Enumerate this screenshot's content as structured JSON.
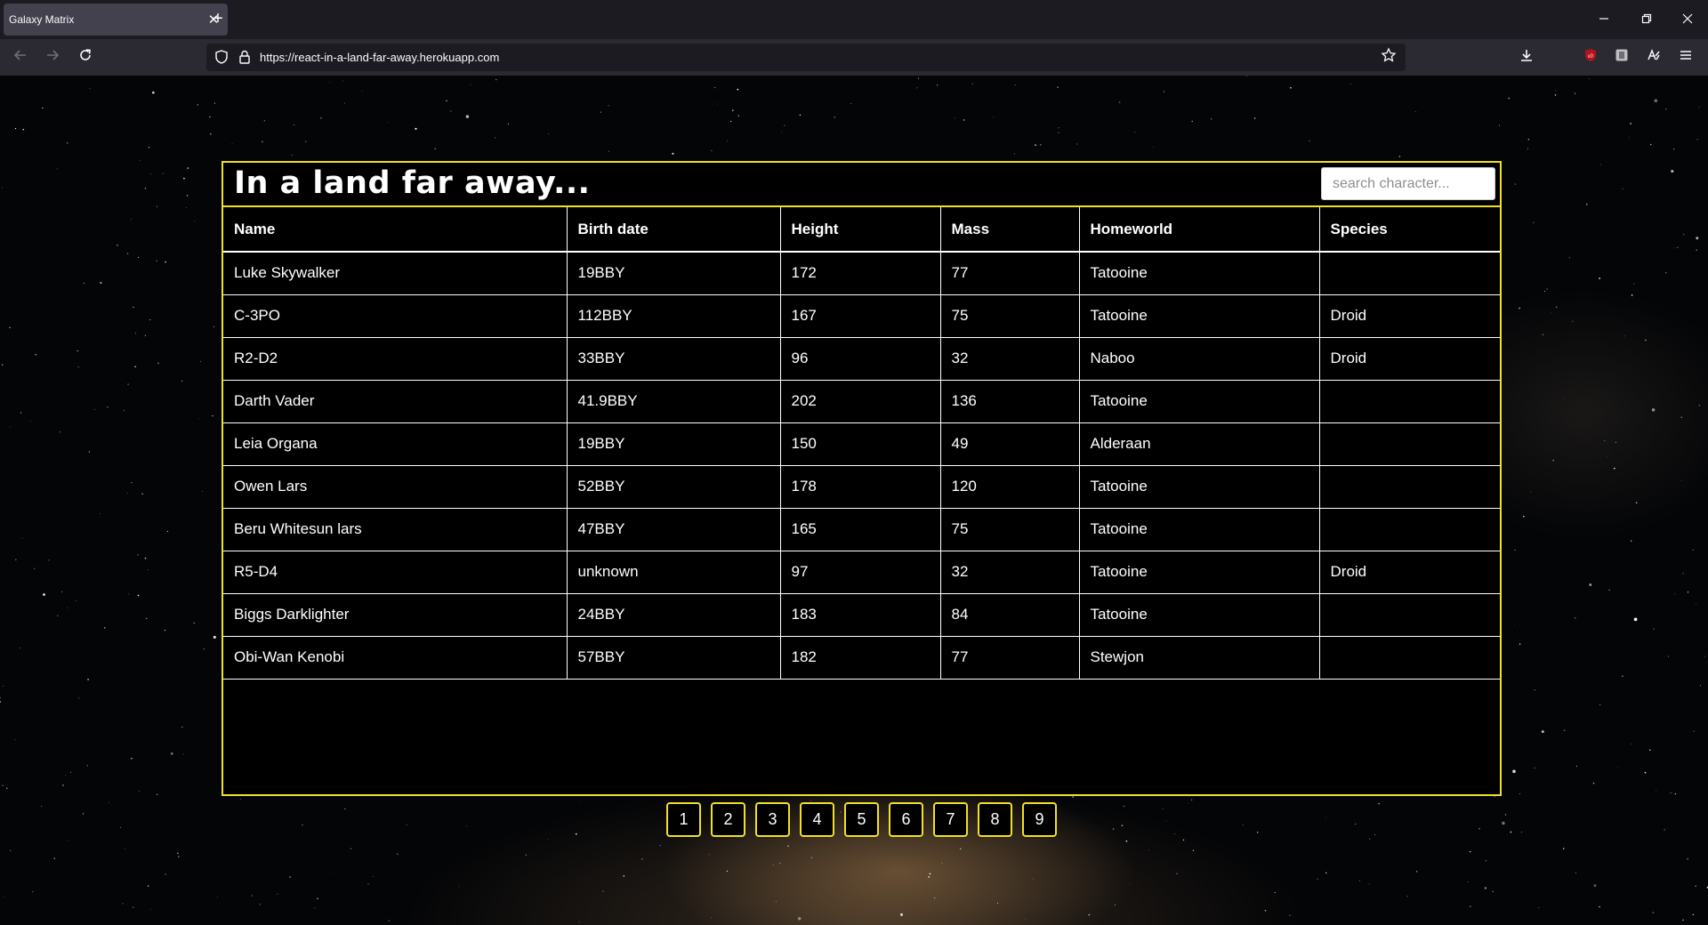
{
  "browser": {
    "tab_title": "Galaxy Matrix",
    "url": "https://react-in-a-land-far-away.herokuapp.com",
    "tab_close_glyph": "✕",
    "new_tab_glyph": "+",
    "icons": [
      "back-arrow-icon",
      "forward-arrow-icon",
      "reload-icon",
      "shield-icon",
      "lock-icon",
      "star-bookmark-icon",
      "download-icon",
      "ublock-extension-icon",
      "extension-icon",
      "reader-icon",
      "hamburger-menu-icon",
      "minimize-icon",
      "restore-icon",
      "close-icon"
    ]
  },
  "app": {
    "title": "In a land far away...",
    "search_placeholder": "search character...",
    "accent_color": "#f2e025",
    "columns": [
      "Name",
      "Birth date",
      "Height",
      "Mass",
      "Homeworld",
      "Species"
    ],
    "rows": [
      [
        "Luke Skywalker",
        "19BBY",
        "172",
        "77",
        "Tatooine",
        ""
      ],
      [
        "C-3PO",
        "112BBY",
        "167",
        "75",
        "Tatooine",
        "Droid"
      ],
      [
        "R2-D2",
        "33BBY",
        "96",
        "32",
        "Naboo",
        "Droid"
      ],
      [
        "Darth Vader",
        "41.9BBY",
        "202",
        "136",
        "Tatooine",
        ""
      ],
      [
        "Leia Organa",
        "19BBY",
        "150",
        "49",
        "Alderaan",
        ""
      ],
      [
        "Owen Lars",
        "52BBY",
        "178",
        "120",
        "Tatooine",
        ""
      ],
      [
        "Beru Whitesun lars",
        "47BBY",
        "165",
        "75",
        "Tatooine",
        ""
      ],
      [
        "R5-D4",
        "unknown",
        "97",
        "32",
        "Tatooine",
        "Droid"
      ],
      [
        "Biggs Darklighter",
        "24BBY",
        "183",
        "84",
        "Tatooine",
        ""
      ],
      [
        "Obi-Wan Kenobi",
        "57BBY",
        "182",
        "77",
        "Stewjon",
        ""
      ]
    ],
    "pages": [
      "1",
      "2",
      "3",
      "4",
      "5",
      "6",
      "7",
      "8",
      "9"
    ]
  }
}
